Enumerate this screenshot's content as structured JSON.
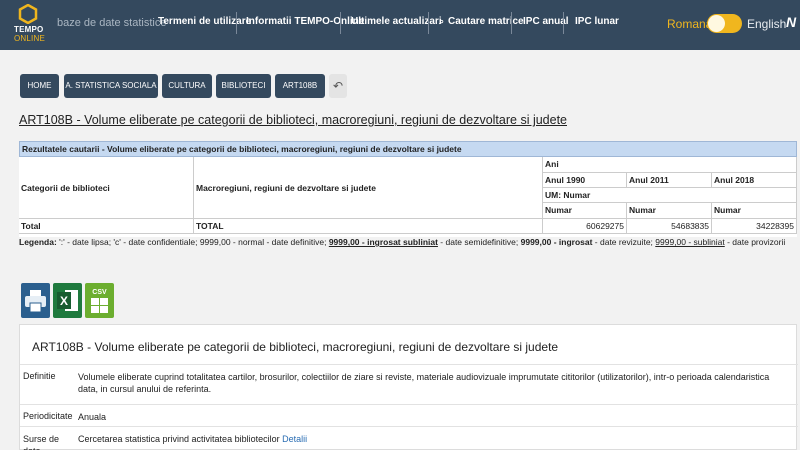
{
  "header": {
    "logo_line1": "TEMPO",
    "logo_line2": "ONLINE",
    "subtitle": "baze de date statistice",
    "nav": [
      "Termeni de utilizare",
      "Informatii TEMPO-Online",
      "Ultimele actualizari",
      "Cautare matrice",
      "IPC anual",
      "IPC lunar"
    ],
    "lang_ro": "Romana",
    "lang_en": "English",
    "edge_glyph": "N"
  },
  "colors": {
    "header_bg": "#34495e",
    "accent": "#f0b61e",
    "table_head": "#c5d9f1",
    "link": "#2a6db3"
  },
  "breadcrumb": [
    "HOME",
    "A. STATISTICA SOCIALA",
    "CULTURA",
    "BIBLIOTECI",
    "ART108B"
  ],
  "back_icon": "↶",
  "page_title": "ART108B - Volume eliberate pe categorii de biblioteci, macroregiuni, regiuni de dezvoltare si judete",
  "table": {
    "caption": "Rezultatele cautarii - Volume eliberate pe categorii de biblioteci, macroregiuni, regiuni de dezvoltare si judete",
    "col1": "Categorii de biblioteci",
    "col2": "Macroregiuni, regiuni de dezvoltare si judete",
    "ani": "Ani",
    "years": [
      "Anul 1990",
      "Anul 2011",
      "Anul 2018"
    ],
    "um": "UM: Numar",
    "units": [
      "Numar",
      "Numar",
      "Numar"
    ],
    "row_label1": "Total",
    "row_label2": "TOTAL",
    "values": [
      "60629275",
      "54683835",
      "34228395"
    ]
  },
  "legend": {
    "label": "Legenda:",
    "p1": " ':' - date lipsa; 'c' - date confidentiale; 9999,00 - normal - date definitive; ",
    "b1": "9999,00 - ingrosat subliniat",
    "p2": " - date semidefinitive; ",
    "b2": "9999,00 - ingrosat",
    "p3": " - date revizuite; ",
    "u1": "9999,00 - subliniat",
    "p4": " - date provizorii"
  },
  "exports": {
    "print": "printer-icon",
    "xls": "X",
    "csv": "CSV"
  },
  "metadata": {
    "title": "ART108B - Volume eliberate pe categorii de biblioteci, macroregiuni, regiuni de dezvoltare si judete",
    "rows": [
      {
        "key": "Definitie",
        "value": "Volumele eliberate cuprind totalitatea cartilor, brosurilor, colectiilor de ziare si reviste, materiale audiovizuale imprumutate cititorilor (utilizatorilor), intr-o perioada calendaristica data, in cursul anului de referinta."
      },
      {
        "key": "Periodicitate",
        "value": "Anuala"
      },
      {
        "key": "Surse de date",
        "value": "Cercetarea statistica privind activitatea bibliotecilor "
      }
    ],
    "link": "Detalii"
  }
}
